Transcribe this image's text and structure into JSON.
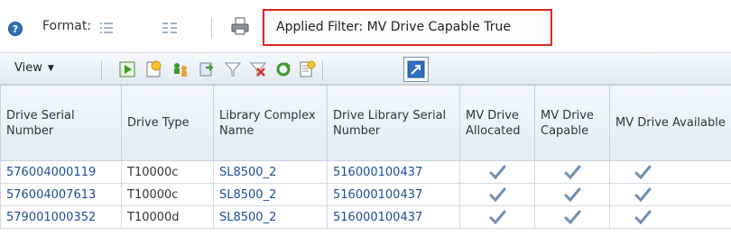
{
  "format_bar": {
    "format_label": "Format:",
    "filter_text": "Applied Filter: MV Drive Capable True",
    "icons": [
      "help-icon",
      "list-format-icon",
      "detail-format-icon",
      "print-icon"
    ]
  },
  "toolbar": {
    "view_label": "View",
    "icons": [
      "run-icon",
      "new-icon",
      "group-icon",
      "export-icon",
      "filter-icon",
      "clear-filter-icon",
      "refresh-icon",
      "edit-icon",
      "detach-icon"
    ]
  },
  "table": {
    "columns": [
      "Drive Serial Number",
      "Drive Type",
      "Library Complex Name",
      "Drive Library Serial Number",
      "MV Drive Allocated",
      "MV Drive Capable",
      "MV Drive Available"
    ],
    "rows": [
      {
        "serial": "576004000119",
        "type": "T10000c",
        "complex": "SL8500_2",
        "lib_serial": "516000100437",
        "allocated": "check",
        "capable": "check",
        "available": "check"
      },
      {
        "serial": "576004007613",
        "type": "T10000c",
        "complex": "SL8500_2",
        "lib_serial": "516000100437",
        "allocated": "check",
        "capable": "check",
        "available": "check"
      },
      {
        "serial": "579001000352",
        "type": "T10000d",
        "complex": "SL8500_2",
        "lib_serial": "516000100437",
        "allocated": "check",
        "capable": "check",
        "available": "check"
      }
    ]
  },
  "colors": {
    "filter_border": "#e2261c",
    "link": "#1a4d99",
    "check": "#6f8fb5"
  }
}
